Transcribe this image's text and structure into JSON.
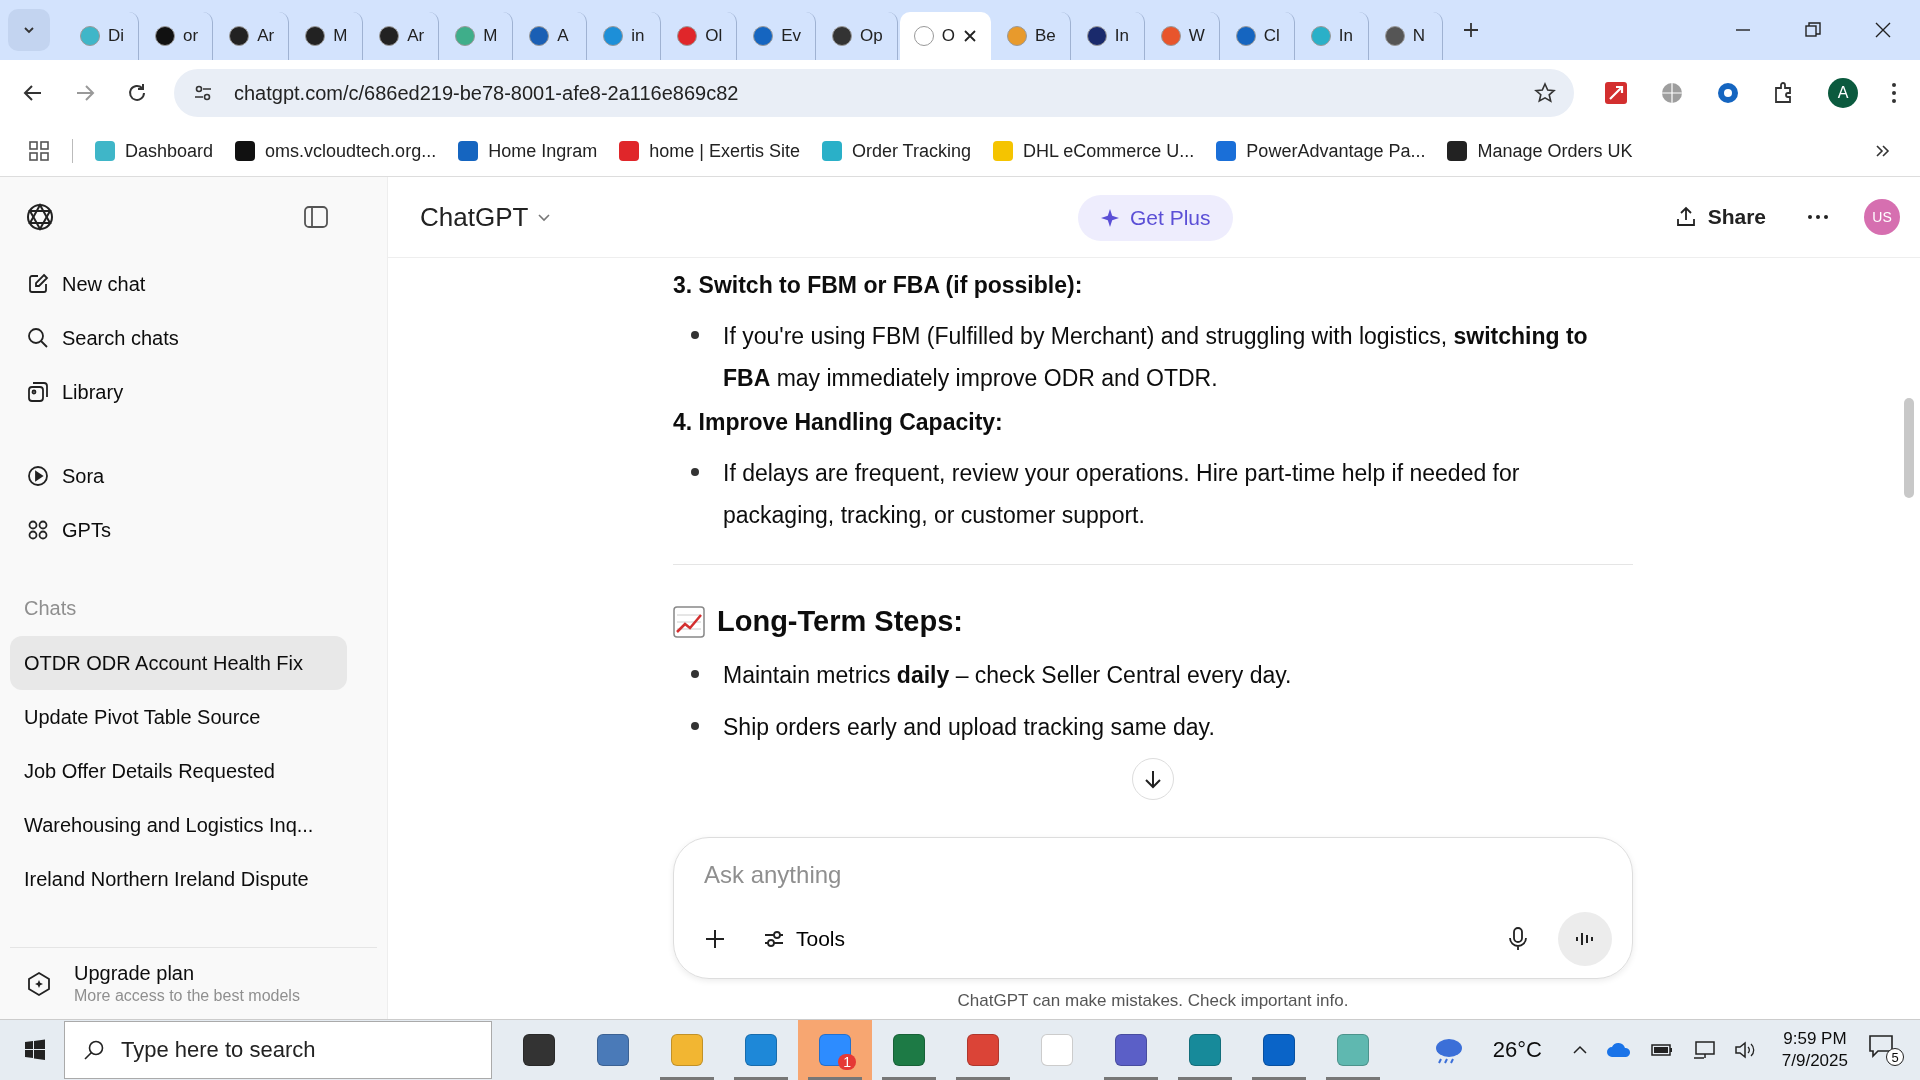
{
  "browser": {
    "tabs": [
      {
        "label": "Di",
        "selected": false,
        "color": "#3fb6c8"
      },
      {
        "label": "or",
        "selected": false,
        "color": "#111111"
      },
      {
        "label": "Ar",
        "selected": false,
        "color": "#222222"
      },
      {
        "label": "M",
        "selected": false,
        "color": "#222222"
      },
      {
        "label": "Ar",
        "selected": false,
        "color": "#222222"
      },
      {
        "label": "M",
        "selected": false,
        "color": "#3fae8a"
      },
      {
        "label": "A",
        "selected": false,
        "color": "#1a5fb4"
      },
      {
        "label": "in",
        "selected": false,
        "color": "#1d8fd8"
      },
      {
        "label": "Ol",
        "selected": false,
        "color": "#e0262a"
      },
      {
        "label": "Ev",
        "selected": false,
        "color": "#1565c0"
      },
      {
        "label": "Op",
        "selected": false,
        "color": "#333333"
      },
      {
        "label": "O",
        "selected": true,
        "color": "#ffffff"
      },
      {
        "label": "Be",
        "selected": false,
        "color": "#e89a2c"
      },
      {
        "label": "In",
        "selected": false,
        "color": "#1a2a6c"
      },
      {
        "label": "W",
        "selected": false,
        "color": "#e8552c"
      },
      {
        "label": "Cl",
        "selected": false,
        "color": "#1565c0"
      },
      {
        "label": "In",
        "selected": false,
        "color": "#2ab0c8"
      },
      {
        "label": "N",
        "selected": false,
        "color": "#555555"
      }
    ],
    "address": "chatgpt.com/c/686ed219-be78-8001-afe8-2a116e869c82",
    "profile": "A",
    "bookmarks": [
      {
        "label": "Dashboard",
        "color": "#3fb6c8"
      },
      {
        "label": "oms.vcloudtech.org...",
        "color": "#111111"
      },
      {
        "label": "Home Ingram",
        "color": "#1565c0"
      },
      {
        "label": "home | Exertis Site",
        "color": "#e0262a"
      },
      {
        "label": "Order Tracking",
        "color": "#2ab0c8"
      },
      {
        "label": "DHL eCommerce U...",
        "color": "#f5c400"
      },
      {
        "label": "PowerAdvantage Pa...",
        "color": "#1a6fd8"
      },
      {
        "label": "Manage Orders UK",
        "color": "#222222"
      }
    ]
  },
  "sidebar": {
    "nav": [
      {
        "label": "New chat",
        "kind": "new"
      },
      {
        "label": "Search chats",
        "kind": "search"
      },
      {
        "label": "Library",
        "kind": "library"
      },
      {
        "label": "Sora",
        "kind": "sora"
      },
      {
        "label": "GPTs",
        "kind": "gpts"
      }
    ],
    "chats_heading": "Chats",
    "chats": [
      {
        "label": "OTDR ODR Account Health Fix",
        "selected": true
      },
      {
        "label": "Update Pivot Table Source",
        "selected": false
      },
      {
        "label": "Job Offer Details Requested",
        "selected": false
      },
      {
        "label": "Warehousing and Logistics Inq...",
        "selected": false
      },
      {
        "label": "Ireland Northern Ireland Dispute",
        "selected": false
      }
    ],
    "upgrade": {
      "title": "Upgrade plan",
      "subtitle": "More access to the best models"
    }
  },
  "header": {
    "model": "ChatGPT",
    "get_plus": "Get Plus",
    "share": "Share",
    "avatar": "US"
  },
  "content": [
    {
      "kind": "step",
      "text": "3. Switch to FBM or FBA (if possible):"
    },
    {
      "kind": "bullet",
      "text": "If you're using FBM (Fulfilled by Merchant) and struggling with logistics, **switching to FBA** may immediately improve ODR and OTDR."
    },
    {
      "kind": "step",
      "text": "4. Improve Handling Capacity:"
    },
    {
      "kind": "bullet",
      "text": "If delays are frequent, review your operations. Hire part-time help if needed for packaging, tracking, or customer support."
    },
    {
      "kind": "divider"
    },
    {
      "kind": "section",
      "text": "Long-Term Steps:"
    },
    {
      "kind": "bullet",
      "text": "Maintain metrics **daily** – check Seller Central every day."
    },
    {
      "kind": "bullet",
      "text": "Ship orders early and upload tracking same day."
    }
  ],
  "composer": {
    "placeholder": "Ask anything",
    "tools": "Tools",
    "disclaimer": "ChatGPT can make mistakes. Check important info."
  },
  "taskbar": {
    "search_placeholder": "Type here to search",
    "apps": [
      {
        "kind": "taskview",
        "running": false
      },
      {
        "kind": "calculator",
        "running": false
      },
      {
        "kind": "folder",
        "running": true
      },
      {
        "kind": "edge",
        "running": true
      },
      {
        "kind": "zoom",
        "running": true
      },
      {
        "kind": "excel",
        "running": true
      },
      {
        "kind": "chrome",
        "running": true
      },
      {
        "kind": "file",
        "running": false
      },
      {
        "kind": "teams",
        "running": true
      },
      {
        "kind": "surfshark",
        "running": true
      },
      {
        "kind": "outlook",
        "running": true
      },
      {
        "kind": "gem",
        "running": true
      }
    ],
    "zoom_badge": "1",
    "temperature": "26°C",
    "time": "9:59 PM",
    "date": "7/9/2025",
    "notifications": "5"
  }
}
